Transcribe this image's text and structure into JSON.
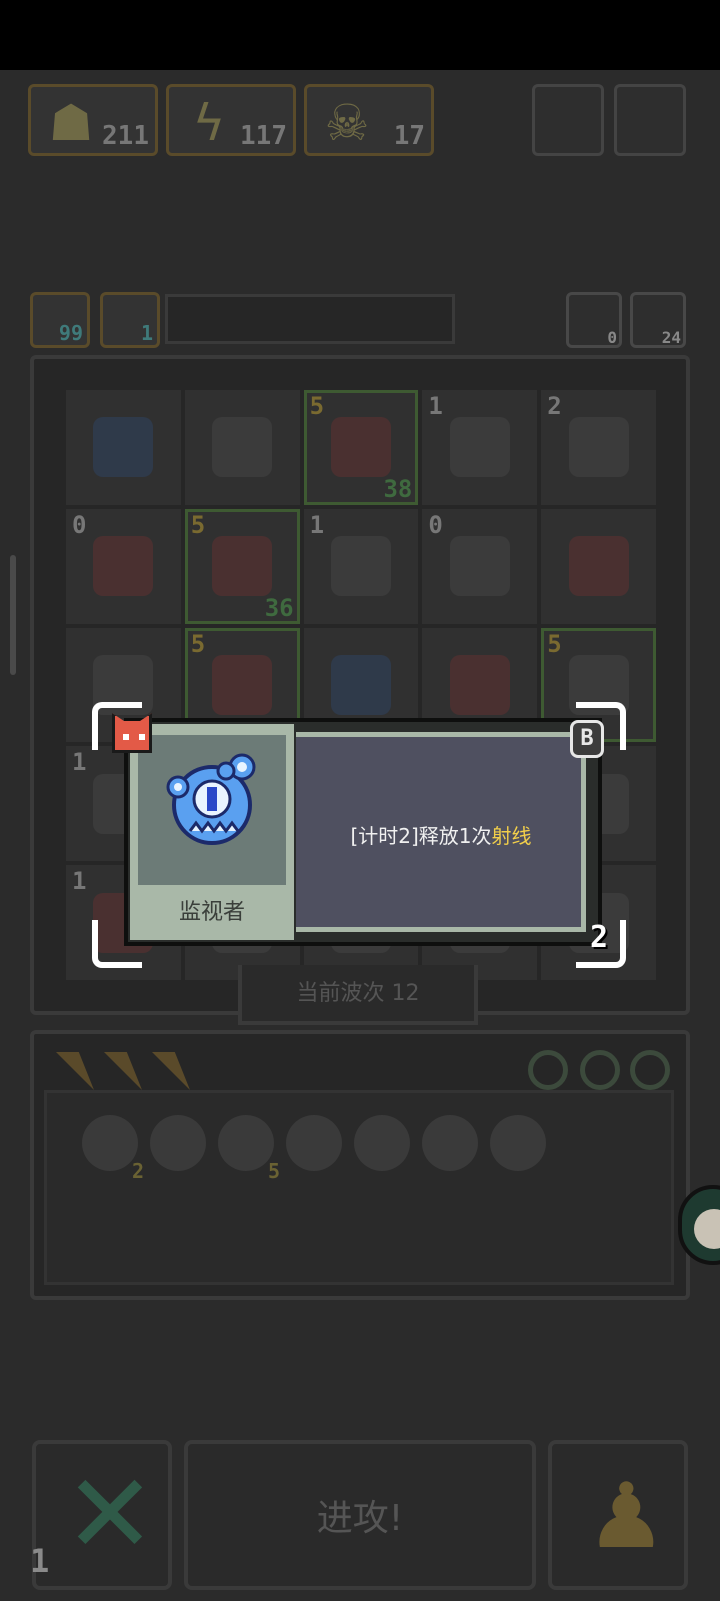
{
  "resources": [
    {
      "name": "hero",
      "value": "211"
    },
    {
      "name": "energy",
      "value": "117"
    },
    {
      "name": "monster",
      "value": "17"
    }
  ],
  "stats": {
    "power": "99",
    "shield": "1",
    "refresh_count": "0",
    "energy_count": "24"
  },
  "board": {
    "cells": [
      {
        "level": "",
        "count": "",
        "tone": "blue",
        "highlight": false
      },
      {
        "level": "",
        "count": "",
        "tone": "",
        "highlight": false
      },
      {
        "level": "5",
        "count": "38",
        "tone": "red",
        "highlight": true
      },
      {
        "level": "1",
        "count": "",
        "tone": "",
        "highlight": false
      },
      {
        "level": "2",
        "count": "",
        "tone": "",
        "highlight": false
      },
      {
        "level": "0",
        "count": "",
        "tone": "red",
        "highlight": false
      },
      {
        "level": "5",
        "count": "36",
        "tone": "red",
        "highlight": true
      },
      {
        "level": "1",
        "count": "",
        "tone": "",
        "highlight": false
      },
      {
        "level": "0",
        "count": "",
        "tone": "",
        "highlight": false
      },
      {
        "level": "",
        "count": "",
        "tone": "red",
        "highlight": false
      },
      {
        "level": "",
        "count": "",
        "tone": "",
        "highlight": false
      },
      {
        "level": "5",
        "count": "",
        "tone": "red",
        "highlight": true
      },
      {
        "level": "",
        "count": "",
        "tone": "blue",
        "highlight": false
      },
      {
        "level": "",
        "count": "",
        "tone": "red",
        "highlight": false
      },
      {
        "level": "5",
        "count": "",
        "tone": "",
        "highlight": true
      },
      {
        "level": "1",
        "count": "",
        "tone": "",
        "highlight": false
      },
      {
        "level": "",
        "count": "",
        "tone": "",
        "highlight": false
      },
      {
        "level": "",
        "count": "",
        "tone": "",
        "highlight": false
      },
      {
        "level": "",
        "count": "",
        "tone": "",
        "highlight": false
      },
      {
        "level": "",
        "count": "",
        "tone": "",
        "highlight": false
      },
      {
        "level": "1",
        "count": "",
        "tone": "red",
        "highlight": false
      },
      {
        "level": "",
        "count": "",
        "tone": "",
        "highlight": false
      },
      {
        "level": "",
        "count": "",
        "tone": "",
        "highlight": false
      },
      {
        "level": "",
        "count": "",
        "tone": "",
        "highlight": false
      },
      {
        "level": "",
        "count": "",
        "tone": "",
        "highlight": false
      }
    ]
  },
  "wave_label": "当前波次 12",
  "inventory": {
    "items": [
      {
        "name": "heart-gem",
        "count": "2"
      },
      {
        "name": "bomb",
        "count": ""
      },
      {
        "name": "cloud",
        "count": "5"
      },
      {
        "name": "potion",
        "count": ""
      },
      {
        "name": "orb",
        "count": ""
      },
      {
        "name": "gear",
        "count": ""
      },
      {
        "name": "shield-charm",
        "count": ""
      }
    ]
  },
  "actions": {
    "attack_label": "进攻!",
    "cancel_count": "1"
  },
  "popup": {
    "unit_name": "监视者",
    "desc_prefix": "[计时2]释放1次",
    "desc_highlight": "射线",
    "badge_letter": "B",
    "level": "2"
  },
  "colors": {
    "accent_yellow": "#f2cf4a",
    "popup_panel": "#a9b8a8",
    "popup_desc_bg": "#4f5060",
    "cat_red": "#e35a47"
  }
}
